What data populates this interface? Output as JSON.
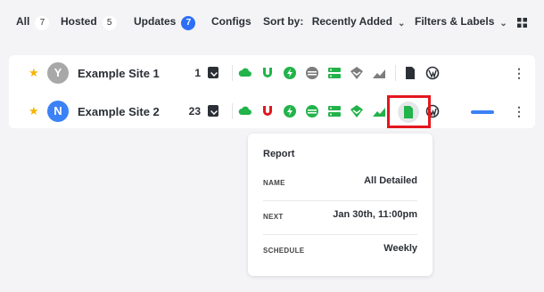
{
  "nav": {
    "all": {
      "label": "All",
      "count": "7"
    },
    "hosted": {
      "label": "Hosted",
      "count": "5"
    },
    "updates": {
      "label": "Updates",
      "count": "7"
    },
    "configs": {
      "label": "Configs"
    },
    "sort_by": {
      "label": "Sort by:",
      "value": "Recently Added"
    },
    "filters": {
      "label": "Filters & Labels"
    }
  },
  "sites": [
    {
      "avatar_letter": "Y",
      "avatar_color": "#a8a8a8",
      "name": "Example Site 1",
      "backups": "1"
    },
    {
      "avatar_letter": "N",
      "avatar_color": "#3b82f6",
      "name": "Example Site 2",
      "backups": "23"
    }
  ],
  "colors": {
    "green": "#22b34a",
    "red": "#e3171d",
    "gray": "#7d7d7d",
    "dark": "#2b2f36",
    "blue": "#3b82f6"
  },
  "popover": {
    "title": "Report",
    "rows": [
      {
        "key": "NAME",
        "value": "All Detailed"
      },
      {
        "key": "NEXT",
        "value": "Jan 30th, 11:00pm"
      },
      {
        "key": "SCHEDULE",
        "value": "Weekly"
      }
    ]
  }
}
